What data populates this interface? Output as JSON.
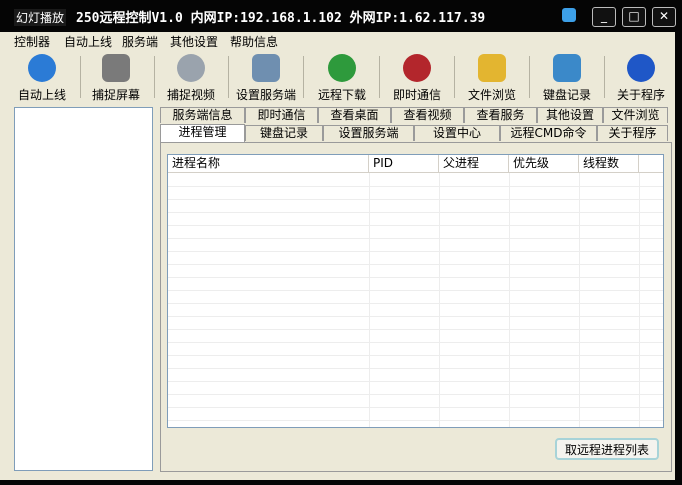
{
  "window": {
    "badge": "幻灯播放",
    "title": "250远程控制V1.0 内网IP:192.168.1.102  外网IP:1.62.117.39",
    "controls": [
      "_",
      "□",
      "✕"
    ]
  },
  "menu": [
    "控制器",
    "自动上线",
    "服务端",
    "其他设置",
    "帮助信息"
  ],
  "toolbar": [
    {
      "label": "自动上线",
      "icon": "globe-icon",
      "color": "#2b7bd6"
    },
    {
      "label": "捕捉屏幕",
      "icon": "camera-icon",
      "color": "#7a7a7a"
    },
    {
      "label": "捕捉视频",
      "icon": "webcam-icon",
      "color": "#9aa3ad"
    },
    {
      "label": "设置服务端",
      "icon": "server-settings-icon",
      "color": "#6f8fb0"
    },
    {
      "label": "远程下载",
      "icon": "download-icon",
      "color": "#2e9a3c"
    },
    {
      "label": "即时通信",
      "icon": "heart-icon",
      "color": "#b3262c"
    },
    {
      "label": "文件浏览",
      "icon": "folder-icon",
      "color": "#e3b530"
    },
    {
      "label": "键盘记录",
      "icon": "keyboard-icon",
      "color": "#3b89c9"
    },
    {
      "label": "关于程序",
      "icon": "help-icon",
      "color": "#1f57c7"
    }
  ],
  "tabs_top": [
    "服务端信息",
    "即时通信",
    "查看桌面",
    "查看视频",
    "查看服务",
    "其他设置",
    "文件浏览"
  ],
  "tabs_bottom": [
    "进程管理",
    "键盘记录",
    "设置服务端",
    "设置中心",
    "远程CMD命令",
    "关于程序"
  ],
  "active_tab": "进程管理",
  "process_list": {
    "columns": [
      "进程名称",
      "PID",
      "父进程",
      "优先级",
      "线程数"
    ],
    "rows": []
  },
  "refresh_button": "取远程进程列表"
}
